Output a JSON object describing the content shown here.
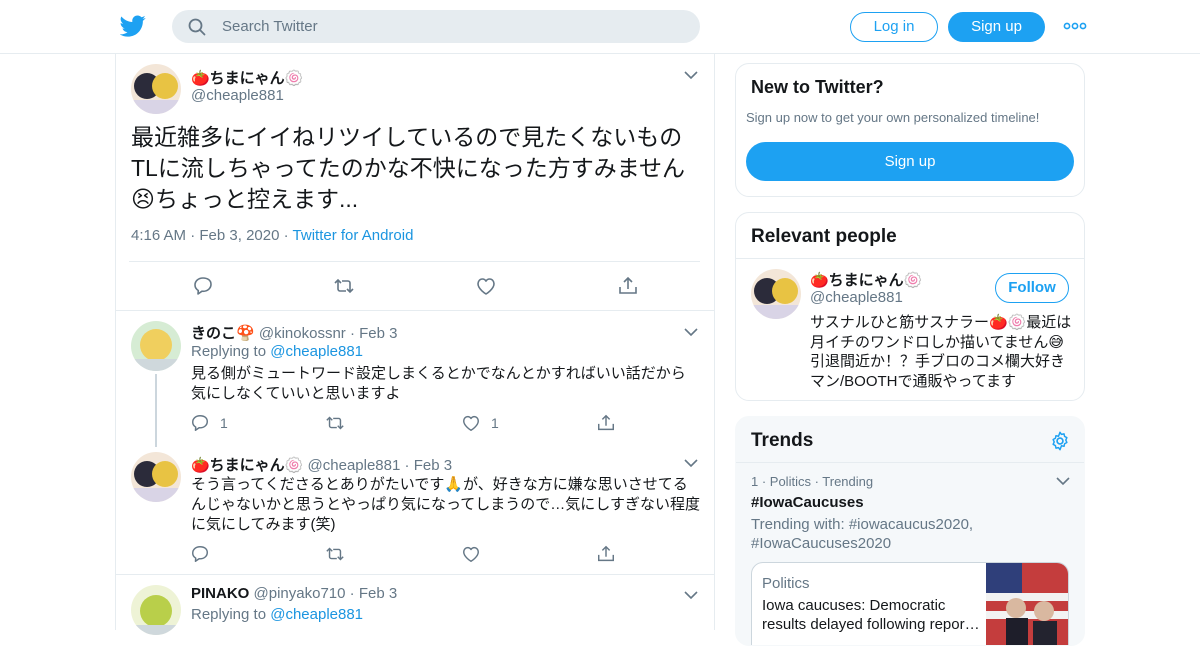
{
  "header": {
    "search_placeholder": "Search Twitter",
    "login_label": "Log in",
    "signup_label": "Sign up"
  },
  "main_tweet": {
    "name": "🍅ちまにゃん🍥",
    "handle": "@cheaple881",
    "text": "最近雑多にイイねリツイしているので見たくないものTLに流しちゃってたのかな不快になった方すみません😣ちょっと控えます...",
    "time": "4:16 AM",
    "date": "Feb 3, 2020",
    "source": "Twitter for Android"
  },
  "replies": [
    {
      "name": "きのこ🍄",
      "handle": "@kinokossnr",
      "date": "Feb 3",
      "replying_prefix": "Replying to",
      "replying_to": "@cheaple881",
      "text": "見る側がミュートワード設定しまくるとかでなんとかすればいい話だから気にしなくていいと思いますよ",
      "reply_count": "1",
      "like_count": "1"
    },
    {
      "name": "🍅ちまにゃん🍥",
      "handle": "@cheaple881",
      "date": "Feb 3",
      "text": "そう言ってくださるとありがたいです🙏が、好きな方に嫌な思いさせてるんじゃないかと思うとやっぱり気になってしまうので…気にしすぎない程度に気にしてみます(笑)"
    },
    {
      "name": "PINAKO",
      "handle": "@pinyako710",
      "date": "Feb 3",
      "replying_prefix": "Replying to",
      "replying_to": "@cheaple881"
    }
  ],
  "sidebar": {
    "new_title": "New to Twitter?",
    "new_sub": "Sign up now to get your own personalized timeline!",
    "new_signup": "Sign up",
    "relevant_title": "Relevant people",
    "person": {
      "name": "🍅ちまにゃん🍥",
      "handle": "@cheaple881",
      "follow_label": "Follow",
      "bio": "サスナルひと筋サスナラー🍅🍥最近は月イチのワンドロしか描いてません😅引退間近か！？手ブロのコメ欄大好きマン/BOOTHで通販やってます"
    },
    "trends_title": "Trends",
    "trend": {
      "meta": "1 · Politics · Trending",
      "name": "#IowaCaucuses",
      "with": "Trending with: #iowacaucus2020, #IowaCaucuses2020",
      "news_category": "Politics",
      "news_headline": "Iowa caucuses: Democratic results delayed following repor…"
    }
  },
  "colors": {
    "brand": "#1da1f2",
    "link": "#1b95e0",
    "muted": "#657786",
    "border": "#e6ecf0"
  }
}
